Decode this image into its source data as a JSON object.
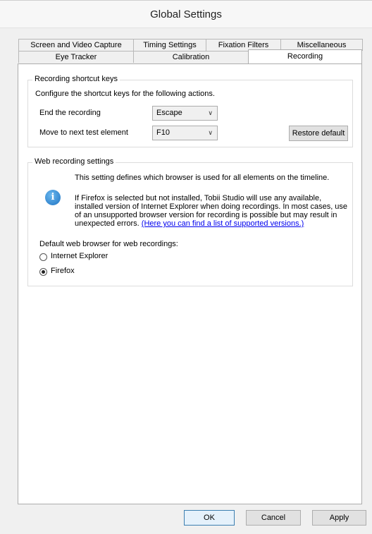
{
  "window": {
    "title": "Global Settings"
  },
  "tabs": {
    "row_top": [
      {
        "label": "Screen and Video Capture"
      },
      {
        "label": "Timing Settings"
      },
      {
        "label": "Fixation Filters"
      },
      {
        "label": "Miscellaneous"
      }
    ],
    "row_bottom": [
      {
        "label": "Eye Tracker"
      },
      {
        "label": "Calibration"
      },
      {
        "label": "Recording",
        "active": true
      }
    ]
  },
  "shortcut_group": {
    "title": "Recording shortcut keys",
    "description": "Configure the shortcut keys for the following actions.",
    "end_recording_label": "End the recording",
    "end_recording_value": "Escape",
    "next_element_label": "Move to next test element",
    "next_element_value": "F10",
    "restore_default_label": "Restore default"
  },
  "web_group": {
    "title": "Web recording settings",
    "info_line1": "This setting defines which browser is used for all elements on the timeline.",
    "info_para2": "If Firefox is selected but not installed, Tobii Studio will use any available, installed version of Internet Explorer when doing recordings. In most cases, use of an unsupported browser version for recording is possible but may result in unexpected errors.",
    "info_link": "(Here you can find a list of supported versions.)",
    "browser_label": "Default web browser for web recordings:",
    "options": [
      {
        "label": "Internet Explorer",
        "checked": false
      },
      {
        "label": "Firefox",
        "checked": true
      }
    ]
  },
  "footer": {
    "ok_label": "OK",
    "cancel_label": "Cancel",
    "apply_label": "Apply"
  },
  "icons": {
    "info": "info-icon",
    "dropdown": "chevron-down-icon"
  }
}
